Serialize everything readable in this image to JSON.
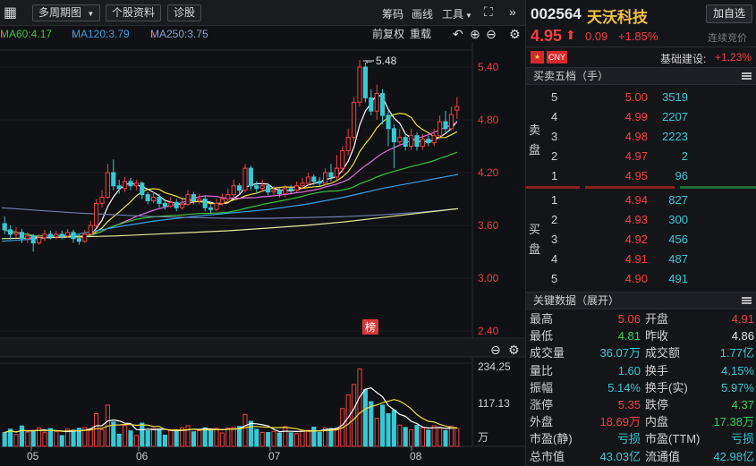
{
  "toolbar": {
    "period_label": "多周期图",
    "profile_label": "个股资料",
    "diagnose_label": "诊股",
    "chips_label": "筹码",
    "draw_label": "画线",
    "tools_label": "工具"
  },
  "ma": {
    "ma60": "MA60:4.17",
    "ma120": "MA120:3.79",
    "ma250": "MA250:3.75",
    "adjust_label": "前复权",
    "overlay_label": "重载"
  },
  "axis": {
    "price_ticks": [
      "5.40",
      "4.80",
      "4.20",
      "3.60",
      "3.00",
      "2.40"
    ],
    "vol_ticks": [
      "234.25",
      "117.13"
    ],
    "vol_unit": "万",
    "months": [
      "05",
      "06",
      "07",
      "08"
    ],
    "high_marker": "5.48",
    "bang_label": "榜"
  },
  "stock": {
    "code": "002564",
    "name": "天沃科技",
    "add_label": "加自选",
    "price": "4.95",
    "change": "0.09",
    "change_pct": "+1.85%",
    "status": "连续竞价",
    "currency": "CNY",
    "sector": "基础建设:",
    "sector_pct": "+1.23%"
  },
  "orderbook": {
    "title": "买卖五档（手）",
    "sell_label_1": "卖",
    "sell_label_2": "盘",
    "buy_label_1": "买",
    "buy_label_2": "盘",
    "asks": [
      {
        "level": "5",
        "price": "5.00",
        "vol": "3519"
      },
      {
        "level": "4",
        "price": "4.99",
        "vol": "2207"
      },
      {
        "level": "3",
        "price": "4.98",
        "vol": "2223"
      },
      {
        "level": "2",
        "price": "4.97",
        "vol": "2"
      },
      {
        "level": "1",
        "price": "4.95",
        "vol": "96"
      }
    ],
    "bids": [
      {
        "level": "1",
        "price": "4.94",
        "vol": "827"
      },
      {
        "level": "2",
        "price": "4.93",
        "vol": "300"
      },
      {
        "level": "3",
        "price": "4.92",
        "vol": "456"
      },
      {
        "level": "4",
        "price": "4.91",
        "vol": "487"
      },
      {
        "level": "5",
        "price": "4.90",
        "vol": "491"
      }
    ]
  },
  "keydata": {
    "title": "关键数据（展开）",
    "rows": [
      [
        {
          "k": "最高",
          "v": "5.06",
          "c": "red"
        },
        {
          "k": "开盘",
          "v": "4.91",
          "c": "red"
        }
      ],
      [
        {
          "k": "最低",
          "v": "4.81",
          "c": "green"
        },
        {
          "k": "昨收",
          "v": "4.86",
          "c": "white"
        }
      ],
      [
        {
          "k": "成交量",
          "v": "36.07万",
          "c": "cyan"
        },
        {
          "k": "成交额",
          "v": "1.77亿",
          "c": "cyan"
        }
      ],
      [
        {
          "k": "量比",
          "v": "1.60",
          "c": "cyan"
        },
        {
          "k": "换手",
          "v": "4.15%",
          "c": "cyan"
        }
      ],
      [
        {
          "k": "振幅",
          "v": "5.14%",
          "c": "cyan"
        },
        {
          "k": "换手(实)",
          "v": "5.97%",
          "c": "cyan"
        }
      ],
      [
        {
          "k": "涨停",
          "v": "5.35",
          "c": "red"
        },
        {
          "k": "跌停",
          "v": "4.37",
          "c": "green"
        }
      ],
      [
        {
          "k": "外盘",
          "v": "18.69万",
          "c": "red"
        },
        {
          "k": "内盘",
          "v": "17.38万",
          "c": "green"
        }
      ],
      [
        {
          "k": "市盈(静)",
          "v": "亏损",
          "c": "cyan"
        },
        {
          "k": "市盈(TTM)",
          "v": "亏损",
          "c": "cyan"
        }
      ],
      [
        {
          "k": "总市值",
          "v": "43.03亿",
          "c": "cyan"
        },
        {
          "k": "流通值",
          "v": "42.98亿",
          "c": "cyan"
        }
      ]
    ]
  },
  "colors": {
    "up": "#f04040",
    "down": "#37c8d6",
    "ma5": "#ffffff",
    "ma10": "#f0e040",
    "ma20": "#e070e0",
    "ma60": "#40c040",
    "ma120": "#3a9fe0",
    "ma250": "#e8e8a0"
  }
}
